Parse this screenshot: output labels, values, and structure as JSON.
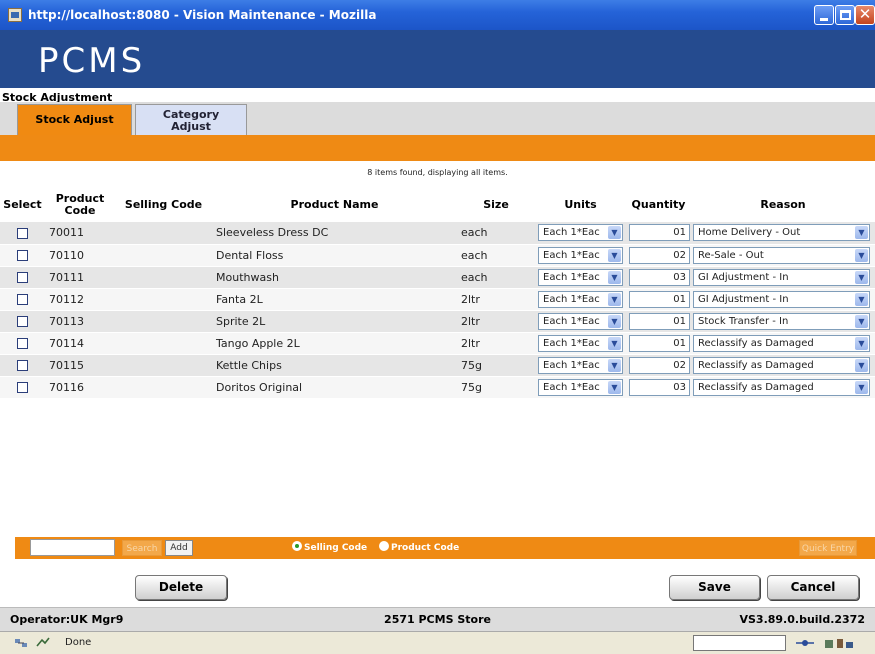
{
  "window": {
    "title": "http://localhost:8080 - Vision Maintenance - Mozilla",
    "close_glyph": "✕"
  },
  "header": {
    "logo_text": "PCMS"
  },
  "page": {
    "section_title": "Stock Adjustment",
    "tabs": [
      {
        "label": "Stock Adjust",
        "active": true
      },
      {
        "label_line1": "Category",
        "label_line2": "Adjust",
        "active": false
      }
    ],
    "results_message": "8 items found, displaying all items."
  },
  "table": {
    "headers": {
      "select": "Select",
      "product_code_l1": "Product",
      "product_code_l2": "Code",
      "selling_code": "Selling Code",
      "product_name": "Product Name",
      "size": "Size",
      "units": "Units",
      "quantity": "Quantity",
      "reason": "Reason"
    },
    "rows": [
      {
        "code": "70011",
        "selling_code": "",
        "name": "Sleeveless Dress DC",
        "size": "each",
        "units": "Each 1*Eac",
        "quantity": "01",
        "reason": "Home Delivery - Out",
        "checked": false
      },
      {
        "code": "70110",
        "selling_code": "",
        "name": "Dental Floss",
        "size": "each",
        "units": "Each 1*Eac",
        "quantity": "02",
        "reason": "Re-Sale - Out",
        "checked": false
      },
      {
        "code": "70111",
        "selling_code": "",
        "name": "Mouthwash",
        "size": "each",
        "units": "Each 1*Eac",
        "quantity": "03",
        "reason": "GI Adjustment - In",
        "checked": false
      },
      {
        "code": "70112",
        "selling_code": "",
        "name": "Fanta 2L",
        "size": "2ltr",
        "units": "Each 1*Eac",
        "quantity": "01",
        "reason": "GI Adjustment - In",
        "checked": false
      },
      {
        "code": "70113",
        "selling_code": "",
        "name": "Sprite 2L",
        "size": "2ltr",
        "units": "Each 1*Eac",
        "quantity": "01",
        "reason": "Stock Transfer - In",
        "checked": false
      },
      {
        "code": "70114",
        "selling_code": "",
        "name": "Tango Apple 2L",
        "size": "2ltr",
        "units": "Each 1*Eac",
        "quantity": "01",
        "reason": "Reclassify as Damaged",
        "checked": false
      },
      {
        "code": "70115",
        "selling_code": "",
        "name": "Kettle Chips",
        "size": "75g",
        "units": "Each 1*Eac",
        "quantity": "02",
        "reason": "Reclassify as Damaged",
        "checked": false
      },
      {
        "code": "70116",
        "selling_code": "",
        "name": "Doritos Original",
        "size": "75g",
        "units": "Each 1*Eac",
        "quantity": "03",
        "reason": "Reclassify as Damaged",
        "checked": false
      }
    ]
  },
  "search_bar": {
    "search_value": "",
    "search_label": "Search",
    "add_label": "Add",
    "radio_selling_code": "Selling Code",
    "radio_product_code": "Product Code",
    "selected_radio": "selling_code",
    "quick_entry_label": "Quick Entry"
  },
  "actions": {
    "delete": "Delete",
    "save": "Save",
    "cancel": "Cancel"
  },
  "footer": {
    "operator": "Operator:UK Mgr9",
    "store": "2571 PCMS Store",
    "version": "VS3.89.0.build.2372"
  },
  "browser_status": {
    "text": "Done"
  },
  "colors": {
    "orange": "#ef8a14",
    "header_blue": "#254b8f",
    "titlebar_blue": "#2563d8"
  },
  "icons": {
    "dropdown": "▼"
  }
}
